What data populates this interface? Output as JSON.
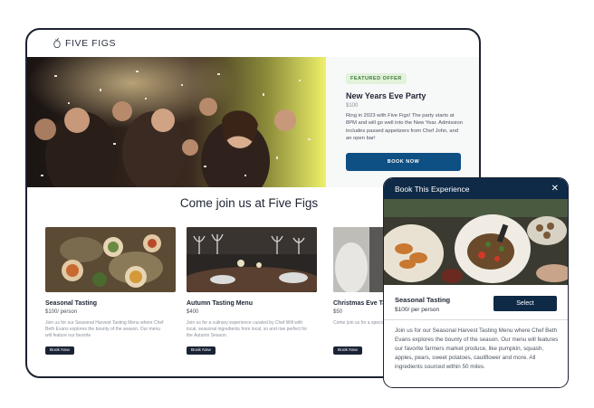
{
  "brand": {
    "name": "FIVE FIGS",
    "icon": "fig-icon"
  },
  "hero": {
    "badge": "FEATURED OFFER",
    "title": "New Years Eve Party",
    "price": "$100",
    "description": "Ring in 2023 with Five Figs! The party starts at 8PM and will go well into the New Year. Admission includes passed appetizers from Chef John, and an open bar!",
    "button": "BOOK NOW"
  },
  "section": {
    "heading": "Come join us at Five Figs"
  },
  "cards": [
    {
      "title": "Seasonal Tasting",
      "price": "$100/ person",
      "description": "Join us for our Seasonal Harvest Tasting Menu where Chef Beth Evans explores the bounty of the season. Our menu will feature our favorite",
      "button": "Book Now"
    },
    {
      "title": "Autumn Tasting Menu",
      "price": "$400",
      "description": "Join us for a culinary experience curated by Chef Will with local, seasonal ingredients from local, so and rise perfect for the Autumn Season.",
      "button": "Book Now"
    },
    {
      "title": "Christmas Eve Ta",
      "price": "$50",
      "description": "Come join us for a special menu from the chef",
      "button": "Book Now"
    }
  ],
  "modal": {
    "title": "Book This Experience",
    "close_icon": "close-icon",
    "item_title": "Seasonal Tasting",
    "item_price": "$100/ per person",
    "select_label": "Select",
    "description": "Join us for our Seasonal Harvest Tasting Menu where Chef Beth Evans explores the bounty of the season. Our menu will features our favorite farmers market produce, like pumpkin, squash, apples, pears, sweet potatoes, cauliflower and more. All ingredients sourced within 50 miles."
  },
  "colors": {
    "primary": "#0e4f84",
    "modal_header": "#0e2a47",
    "badge_bg": "#e2f2db",
    "badge_text": "#3c7a3a",
    "dark_button": "#1a2335"
  }
}
